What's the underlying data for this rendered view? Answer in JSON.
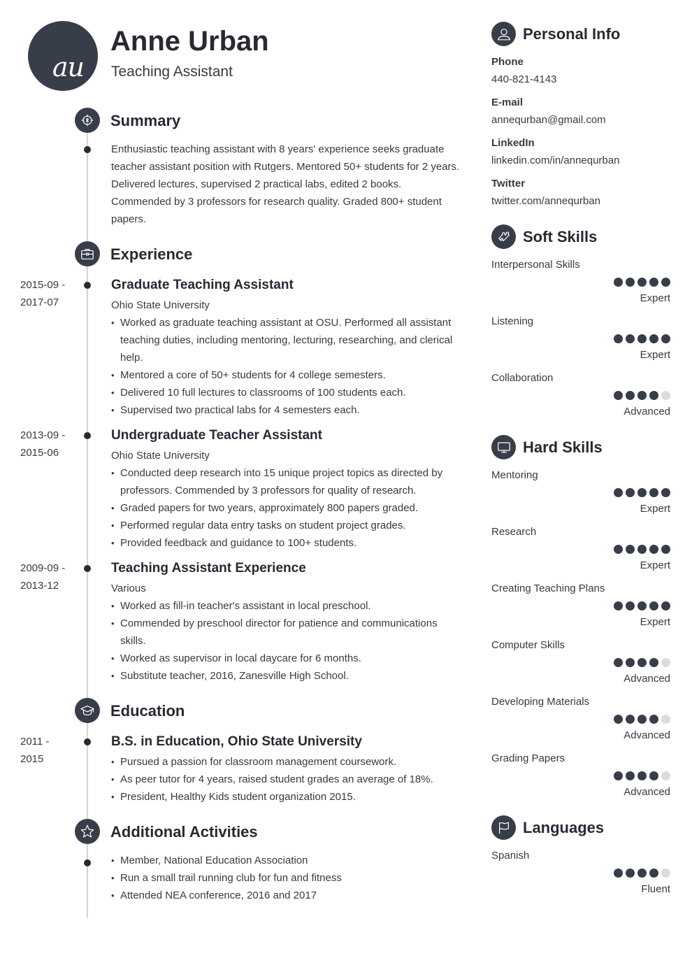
{
  "header": {
    "initials": "au",
    "name": "Anne Urban",
    "role": "Teaching Assistant"
  },
  "sections": {
    "summary": {
      "title": "Summary",
      "icon": "target-icon",
      "text": "Enthusiastic teaching assistant with 8 years' experience seeks graduate teacher assistant position with Rutgers. Mentored 50+ students for 2 years. Delivered lectures, supervised 2 practical labs, edited 2 books. Commended by 3 professors for research quality. Graded 800+ student papers."
    },
    "experience": {
      "title": "Experience",
      "icon": "briefcase-icon",
      "entries": [
        {
          "date_start": "2015-09 -",
          "date_end": "2017-07",
          "title": "Graduate Teaching Assistant",
          "org": "Ohio State University",
          "bullets": [
            "Worked as graduate teaching assistant at OSU. Performed all assistant teaching duties, including mentoring, lecturing, researching, and clerical help.",
            "Mentored a core of 50+ students for 4 college semesters.",
            "Delivered 10 full lectures to classrooms of 100 students each.",
            "Supervised two practical labs for 4 semesters each."
          ]
        },
        {
          "date_start": "2013-09 -",
          "date_end": "2015-06",
          "title": "Undergraduate Teacher Assistant",
          "org": "Ohio State University",
          "bullets": [
            "Conducted deep research into 15 unique project topics as directed by professors. Commended by 3 professors for quality of research.",
            "Graded papers for two years, approximately 800 papers graded.",
            "Performed regular data entry tasks on student project grades.",
            "Provided feedback and guidance to 100+ students."
          ]
        },
        {
          "date_start": "2009-09 -",
          "date_end": "2013-12",
          "title": "Teaching Assistant Experience",
          "org": "Various",
          "bullets": [
            "Worked as fill-in teacher's assistant in local preschool.",
            "Commended by preschool director for patience and communications skills.",
            "Worked as supervisor in local daycare for 6 months.",
            "Substitute teacher, 2016, Zanesville High School."
          ]
        }
      ]
    },
    "education": {
      "title": "Education",
      "icon": "graduation-cap-icon",
      "entries": [
        {
          "date_start": "2011 -",
          "date_end": "2015",
          "title": "B.S. in Education, Ohio State University",
          "bullets": [
            "Pursued a passion for classroom management coursework.",
            "As peer tutor for 4 years, raised student grades an average of 18%.",
            "President, Healthy Kids student organization 2015."
          ]
        }
      ]
    },
    "activities": {
      "title": "Additional Activities",
      "icon": "star-icon",
      "bullets": [
        "Member, National Education Association",
        "Run a small trail running club for fun and fitness",
        "Attended NEA conference, 2016 and 2017"
      ]
    }
  },
  "sidebar": {
    "personal_info": {
      "title": "Personal Info",
      "icon": "user-icon",
      "items": [
        {
          "label": "Phone",
          "value": "440-821-4143"
        },
        {
          "label": "E-mail",
          "value": "annequrban@gmail.com"
        },
        {
          "label": "LinkedIn",
          "value": "linkedin.com/in/annequrban"
        },
        {
          "label": "Twitter",
          "value": "twitter.com/annequrban"
        }
      ]
    },
    "soft_skills": {
      "title": "Soft Skills",
      "icon": "puzzle-icon",
      "items": [
        {
          "name": "Interpersonal Skills",
          "rating": 5,
          "max": 5,
          "level": "Expert"
        },
        {
          "name": "Listening",
          "rating": 5,
          "max": 5,
          "level": "Expert"
        },
        {
          "name": "Collaboration",
          "rating": 4,
          "max": 5,
          "level": "Advanced"
        }
      ]
    },
    "hard_skills": {
      "title": "Hard Skills",
      "icon": "monitor-icon",
      "items": [
        {
          "name": "Mentoring",
          "rating": 5,
          "max": 5,
          "level": "Expert"
        },
        {
          "name": "Research",
          "rating": 5,
          "max": 5,
          "level": "Expert"
        },
        {
          "name": "Creating Teaching Plans",
          "rating": 5,
          "max": 5,
          "level": "Expert"
        },
        {
          "name": "Computer Skills",
          "rating": 4,
          "max": 5,
          "level": "Advanced"
        },
        {
          "name": "Developing Materials",
          "rating": 4,
          "max": 5,
          "level": "Advanced"
        },
        {
          "name": "Grading Papers",
          "rating": 4,
          "max": 5,
          "level": "Advanced"
        }
      ]
    },
    "languages": {
      "title": "Languages",
      "icon": "flag-icon",
      "items": [
        {
          "name": "Spanish",
          "rating": 4,
          "max": 5,
          "level": "Fluent"
        }
      ]
    }
  },
  "colors": {
    "accent_dark": "#383d4a",
    "text": "#383a40",
    "heading": "#272a33",
    "timeline_line": "#d4d4d4",
    "dot_off": "#dcdcdc"
  }
}
